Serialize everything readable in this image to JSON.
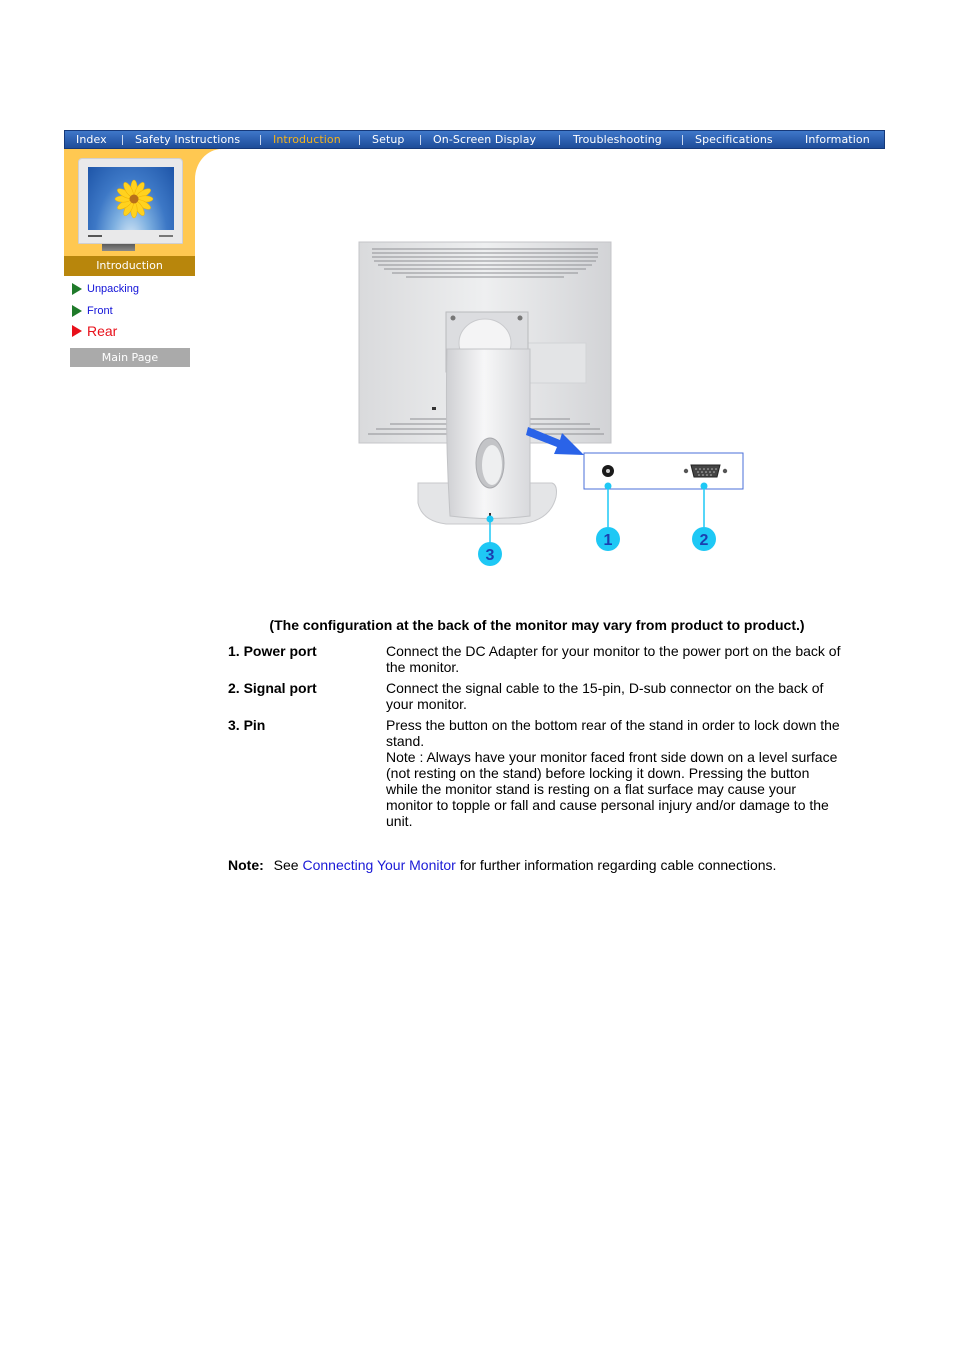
{
  "nav": {
    "items": [
      {
        "label": "Index",
        "active": false
      },
      {
        "label": "Safety Instructions",
        "active": false
      },
      {
        "label": "Introduction",
        "active": true
      },
      {
        "label": "Setup",
        "active": false
      },
      {
        "label": "On-Screen Display",
        "active": false
      },
      {
        "label": "Troubleshooting",
        "active": false
      },
      {
        "label": "Specifications",
        "active": false
      },
      {
        "label": "Information",
        "active": false
      }
    ]
  },
  "sidebar": {
    "section_title": "Introduction",
    "links": [
      {
        "label": "Unpacking",
        "current": false
      },
      {
        "label": "Front",
        "current": false
      },
      {
        "label": "Rear",
        "current": true
      }
    ],
    "main_page_label": "Main Page"
  },
  "figure": {
    "callouts": [
      "1",
      "2",
      "3"
    ],
    "callout_color": "#1ec8f5",
    "callout_text_color": "#1b3fb0"
  },
  "content": {
    "caption": "(The configuration at the back of the monitor may vary from product to product.)",
    "items": [
      {
        "term": "1. Power port",
        "description": [
          "Connect the DC Adapter for your monitor to the power port on the back of the monitor."
        ]
      },
      {
        "term": "2. Signal port",
        "description": [
          "Connect the signal cable to the 15-pin, D-sub connector on the back of your monitor."
        ]
      },
      {
        "term": "3. Pin",
        "description": [
          "Press the button on the bottom rear of the stand in order to lock down the stand.",
          "Note : Always have your monitor faced front side down on a level surface (not resting on the stand) before locking it down. Pressing the button while the monitor stand is resting on a flat surface may cause your monitor to topple or fall and cause personal injury and/or damage to the unit."
        ]
      }
    ],
    "note": {
      "label": "Note:",
      "prefix": "See",
      "link_text": "Connecting Your Monitor",
      "suffix": "for further information regarding cable connections."
    }
  },
  "colors": {
    "nav_bg": "#2f63b4",
    "nav_active": "#f5b31a",
    "sidebar_yellow": "#ffc851",
    "section_label_bg": "#b8860c",
    "link_blue": "#1a1ad6",
    "current_red": "#e8101a"
  }
}
